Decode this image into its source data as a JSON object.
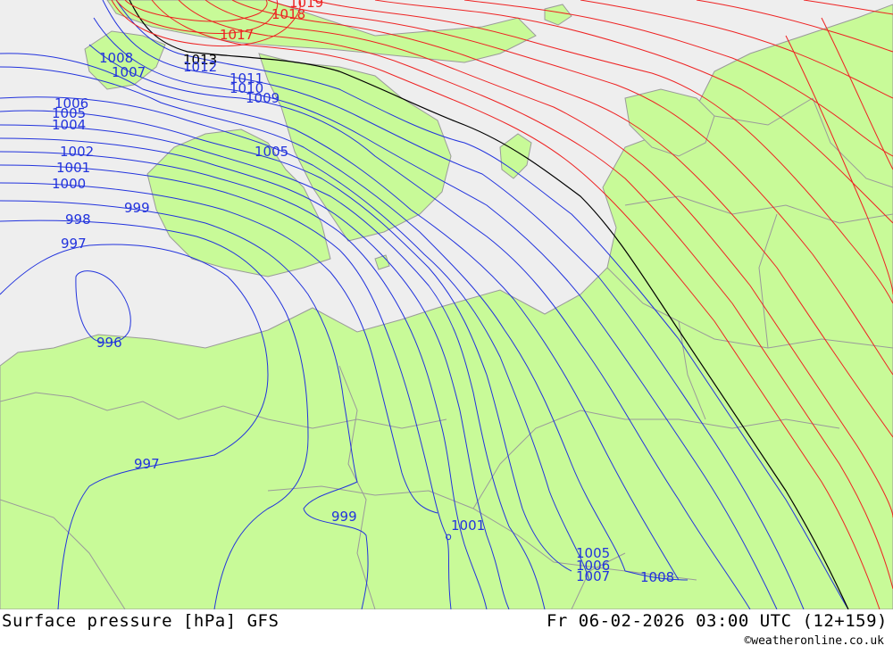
{
  "footer": {
    "title": "Surface pressure [hPa] GFS",
    "valid_time": "Fr 06-02-2026 03:00 UTC (12+159)",
    "credit": "©weatheronline.co.uk"
  },
  "colors": {
    "sea": "#eeeeee",
    "land": "#c8fa98",
    "border": "#9a9a9a",
    "low_isobar": "#2233dd",
    "reference_isobar": "#000000",
    "high_isobar": "#ee2222"
  },
  "isobar_labels": [
    {
      "text": "1019",
      "color": "high"
    },
    {
      "text": "1018",
      "color": "high"
    },
    {
      "text": "1017",
      "color": "high"
    },
    {
      "text": "1013",
      "color": "reference"
    },
    {
      "text": "1012",
      "color": "low"
    },
    {
      "text": "1011",
      "color": "low"
    },
    {
      "text": "1010",
      "color": "low"
    },
    {
      "text": "1009",
      "color": "low"
    },
    {
      "text": "1008",
      "color": "low"
    },
    {
      "text": "1007",
      "color": "low"
    },
    {
      "text": "1006",
      "color": "low"
    },
    {
      "text": "1005",
      "color": "low"
    },
    {
      "text": "1004",
      "color": "low"
    },
    {
      "text": "1005",
      "color": "low"
    },
    {
      "text": "1002",
      "color": "low"
    },
    {
      "text": "1001",
      "color": "low"
    },
    {
      "text": "1000",
      "color": "low"
    },
    {
      "text": "999",
      "color": "low"
    },
    {
      "text": "998",
      "color": "low"
    },
    {
      "text": "997",
      "color": "low"
    },
    {
      "text": "996",
      "color": "low"
    },
    {
      "text": "997",
      "color": "low"
    },
    {
      "text": "999",
      "color": "low"
    },
    {
      "text": "1001",
      "color": "low"
    },
    {
      "text": "1005",
      "color": "low"
    },
    {
      "text": "1006",
      "color": "low"
    },
    {
      "text": "1007",
      "color": "low"
    },
    {
      "text": "1008",
      "color": "low"
    }
  ]
}
